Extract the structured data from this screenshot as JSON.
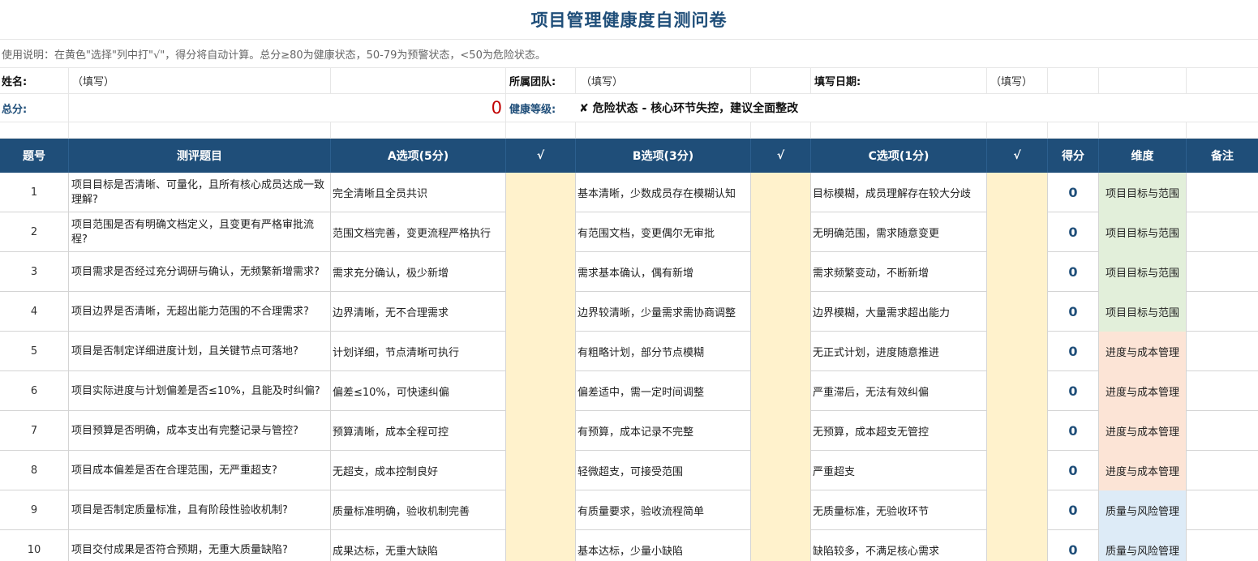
{
  "title": "项目管理健康度自测问卷",
  "instructions": "使用说明：在黄色\"选择\"列中打\"√\"，得分将自动计算。总分≥80为健康状态，50-79为预警状态，<50为危险状态。",
  "info": {
    "name_label": "姓名:",
    "name_value": "（填写）",
    "team_label": "所属团队:",
    "team_value": "（填写）",
    "date_label": "填写日期:",
    "date_value": "（填写）",
    "total_label": "总分:",
    "total_value": "0",
    "level_label": "健康等级:",
    "level_value": "✘ 危险状态 - 核心环节失控，建议全面整改"
  },
  "columns": [
    "题号",
    "测评题目",
    "A选项(5分)",
    "√",
    "B选项(3分)",
    "√",
    "C选项(1分)",
    "√",
    "得分",
    "维度",
    "备注"
  ],
  "rows": [
    {
      "no": "1",
      "question": "项目目标是否清晰、可量化，且所有核心成员达成一致理解?",
      "a": "完全清晰且全员共识",
      "b": "基本清晰，少数成员存在模糊认知",
      "c": "目标模糊，成员理解存在较大分歧",
      "score": "0",
      "dimension": "项目目标与范围",
      "dim_color": "#e2efda"
    },
    {
      "no": "2",
      "question": "项目范围是否有明确文档定义，且变更有严格审批流程?",
      "a": "范围文档完善，变更流程严格执行",
      "b": "有范围文档，变更偶尔无审批",
      "c": "无明确范围，需求随意变更",
      "score": "0",
      "dimension": "项目目标与范围",
      "dim_color": "#e2efda"
    },
    {
      "no": "3",
      "question": "项目需求是否经过充分调研与确认，无频繁新增需求?",
      "a": "需求充分确认，极少新增",
      "b": "需求基本确认，偶有新增",
      "c": "需求频繁变动，不断新增",
      "score": "0",
      "dimension": "项目目标与范围",
      "dim_color": "#e2efda"
    },
    {
      "no": "4",
      "question": "项目边界是否清晰，无超出能力范围的不合理需求?",
      "a": "边界清晰，无不合理需求",
      "b": "边界较清晰，少量需求需协商调整",
      "c": "边界模糊，大量需求超出能力",
      "score": "0",
      "dimension": "项目目标与范围",
      "dim_color": "#e2efda"
    },
    {
      "no": "5",
      "question": "项目是否制定详细进度计划，且关键节点可落地?",
      "a": "计划详细，节点清晰可执行",
      "b": "有粗略计划，部分节点模糊",
      "c": "无正式计划，进度随意推进",
      "score": "0",
      "dimension": "进度与成本管理",
      "dim_color": "#fce4d6"
    },
    {
      "no": "6",
      "question": "项目实际进度与计划偏差是否≤10%，且能及时纠偏?",
      "a": "偏差≤10%，可快速纠偏",
      "b": "偏差适中，需一定时间调整",
      "c": "严重滞后，无法有效纠偏",
      "score": "0",
      "dimension": "进度与成本管理",
      "dim_color": "#fce4d6"
    },
    {
      "no": "7",
      "question": "项目预算是否明确，成本支出有完整记录与管控?",
      "a": "预算清晰，成本全程可控",
      "b": "有预算，成本记录不完整",
      "c": "无预算，成本超支无管控",
      "score": "0",
      "dimension": "进度与成本管理",
      "dim_color": "#fce4d6"
    },
    {
      "no": "8",
      "question": "项目成本偏差是否在合理范围，无严重超支?",
      "a": "无超支，成本控制良好",
      "b": "轻微超支，可接受范围",
      "c": "严重超支",
      "score": "0",
      "dimension": "进度与成本管理",
      "dim_color": "#fce4d6"
    },
    {
      "no": "9",
      "question": "项目是否制定质量标准，且有阶段性验收机制?",
      "a": "质量标准明确，验收机制完善",
      "b": "有质量要求，验收流程简单",
      "c": "无质量标准，无验收环节",
      "score": "0",
      "dimension": "质量与风险管理",
      "dim_color": "#ddebf7"
    },
    {
      "no": "10",
      "question": "项目交付成果是否符合预期，无重大质量缺陷?",
      "a": "成果达标，无重大缺陷",
      "b": "基本达标，少量小缺陷",
      "c": "缺陷较多，不满足核心需求",
      "score": "0",
      "dimension": "质量与风险管理",
      "dim_color": "#ddebf7"
    }
  ]
}
